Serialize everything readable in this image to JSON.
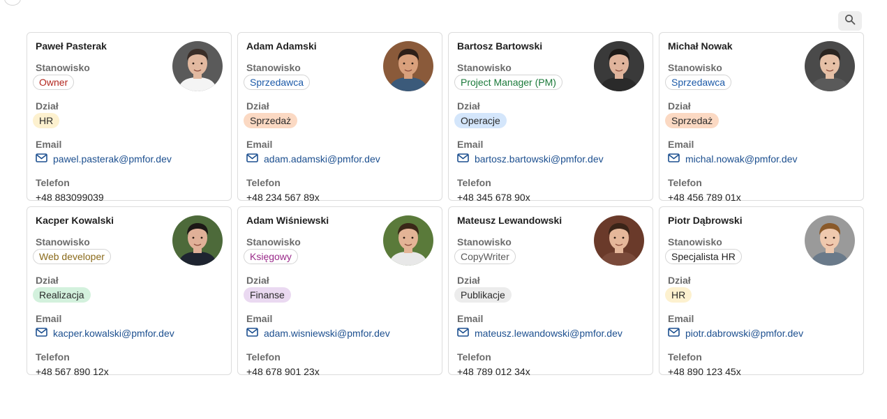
{
  "ui": {
    "labels": {
      "position": "Stanowisko",
      "department": "Dział",
      "email": "Email",
      "phone": "Telefon"
    },
    "icons": {
      "back": "chevron-left-icon",
      "search": "search-icon",
      "email": "envelope-icon"
    },
    "colors": {
      "email_link": "#1c4f8f",
      "search_bg": "#eeeeee",
      "card_border": "#dcdcdc"
    }
  },
  "employees": [
    {
      "name": "Paweł Pasterak",
      "position": "Owner",
      "position_color": "#b3261e",
      "department": "HR",
      "department_bg": "#fdf1cf",
      "email": "pawel.pasterak@pmfor.dev",
      "phone": "+48 883099039",
      "avatar": {
        "bg": "#5a5a5a",
        "skin": "#e2b9a0",
        "hair": "#3a2e28",
        "shirt": "#f4f4f4"
      }
    },
    {
      "name": "Adam Adamski",
      "position": "Sprzedawca",
      "position_color": "#1c5aa8",
      "department": "Sprzedaż",
      "department_bg": "#fbd9c3",
      "email": "adam.adamski@pmfor.dev",
      "phone": "+48 234 567 89x",
      "avatar": {
        "bg": "#8a5a3a",
        "skin": "#d9a07c",
        "hair": "#2e1f18",
        "shirt": "#3b5a7a"
      }
    },
    {
      "name": "Bartosz Bartowski",
      "position": "Project Manager (PM)",
      "position_color": "#1b7a3a",
      "department": "Operacje",
      "department_bg": "#d4e6fb",
      "email": "bartosz.bartowski@pmfor.dev",
      "phone": "+48 345 678 90x",
      "avatar": {
        "bg": "#3a3a3a",
        "skin": "#e0b49c",
        "hair": "#1e1a18",
        "shirt": "#2a2a2a"
      }
    },
    {
      "name": "Michał Nowak",
      "position": "Sprzedawca",
      "position_color": "#1c5aa8",
      "department": "Sprzedaż",
      "department_bg": "#fbd9c3",
      "email": "michal.nowak@pmfor.dev",
      "phone": "+48 456 789 01x",
      "avatar": {
        "bg": "#4a4a4a",
        "skin": "#e6c0a6",
        "hair": "#2a2420",
        "shirt": "#5a5a5a"
      }
    },
    {
      "name": "Kacper Kowalski",
      "position": "Web developer",
      "position_color": "#8a6a1a",
      "department": "Realizacja",
      "department_bg": "#d3f1dd",
      "email": "kacper.kowalski@pmfor.dev",
      "phone": "+48 567 890 12x",
      "avatar": {
        "bg": "#4d6a3a",
        "skin": "#e0b098",
        "hair": "#1c1816",
        "shirt": "#1e2430"
      }
    },
    {
      "name": "Adam Wiśniewski",
      "position": "Księgowy",
      "position_color": "#9a2a8a",
      "department": "Finanse",
      "department_bg": "#ead9f1",
      "email": "adam.wisniewski@pmfor.dev",
      "phone": "+48 678 901 23x",
      "avatar": {
        "bg": "#5a7a3a",
        "skin": "#e3b496",
        "hair": "#3a2818",
        "shirt": "#e8e8e8"
      }
    },
    {
      "name": "Mateusz Lewandowski",
      "position": "CopyWriter",
      "position_color": "#5a5a5a",
      "department": "Publikacje",
      "department_bg": "#ececec",
      "email": "mateusz.lewandowski@pmfor.dev",
      "phone": "+48 789 012 34x",
      "avatar": {
        "bg": "#6a3a2a",
        "skin": "#e5b79a",
        "hair": "#3a2418",
        "shirt": "#7a4a3a"
      }
    },
    {
      "name": "Piotr Dąbrowski",
      "position": "Specjalista HR",
      "position_color": "#222222",
      "department": "HR",
      "department_bg": "#fdf1cf",
      "email": "piotr.dabrowski@pmfor.dev",
      "phone": "+48 890 123 45x",
      "avatar": {
        "bg": "#9a9a9a",
        "skin": "#efc9ae",
        "hair": "#8a5a2a",
        "shirt": "#6a7a8a"
      }
    }
  ]
}
